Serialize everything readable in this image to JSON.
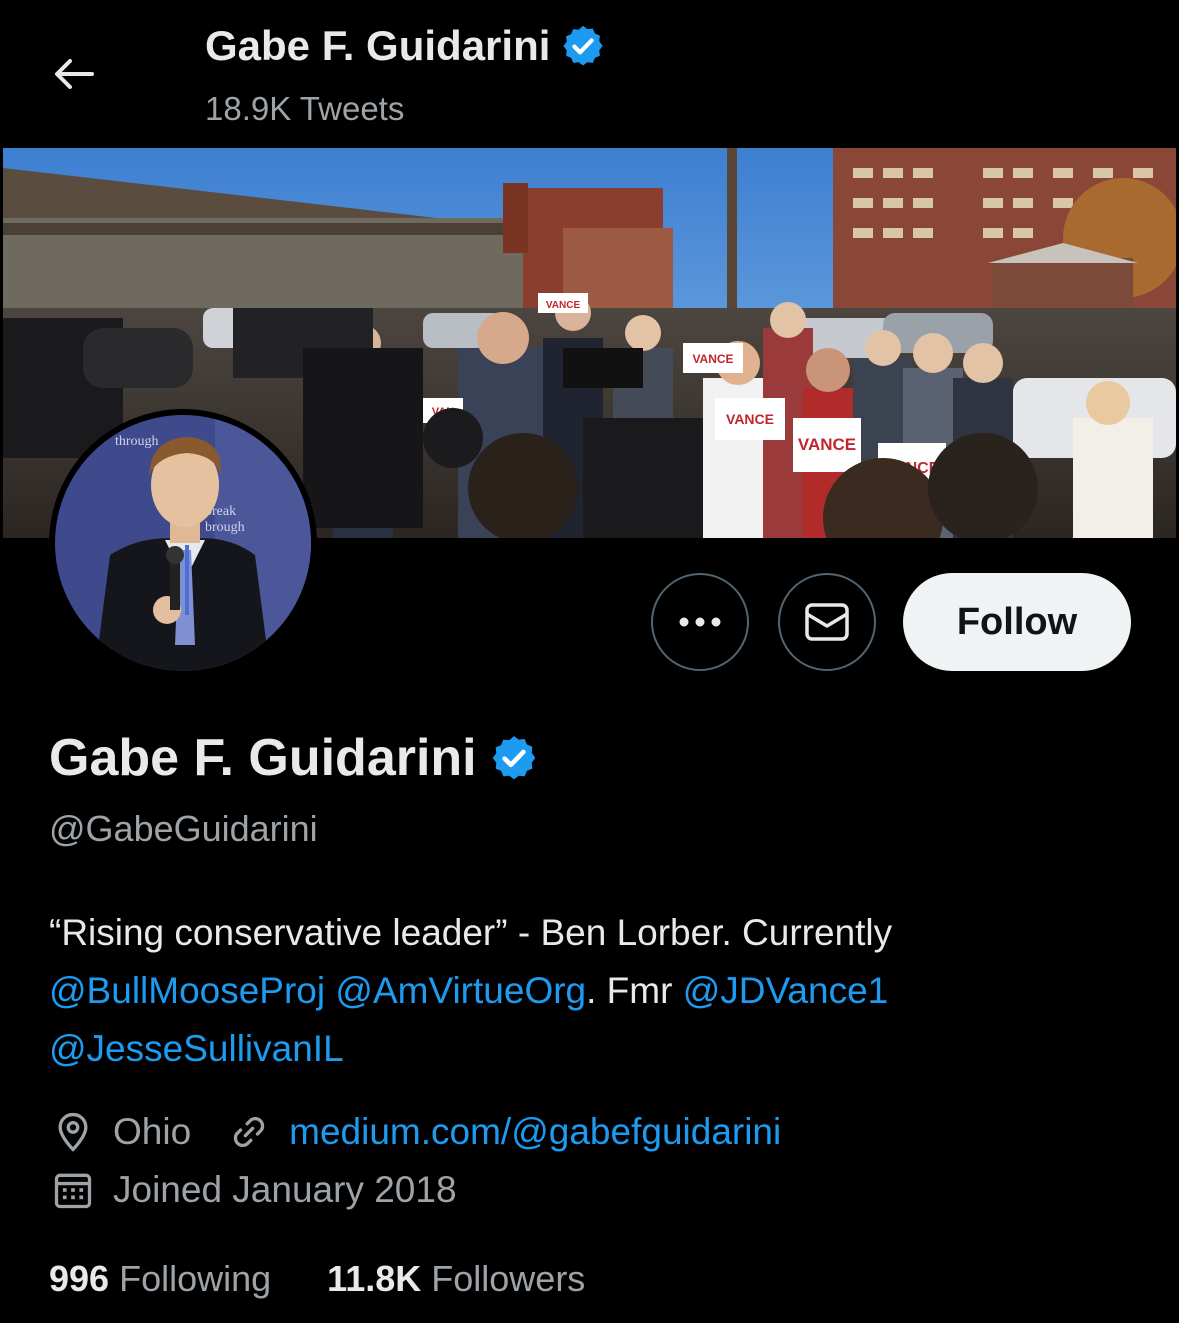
{
  "header": {
    "title": "Gabe F. Guidarini",
    "tweet_count": "18.9K Tweets"
  },
  "actions": {
    "follow_label": "Follow"
  },
  "profile": {
    "name": "Gabe F. Guidarini",
    "handle": "@GabeGuidarini",
    "bio": {
      "text_1": "“Rising conservative leader” - Ben Lorber. Currently",
      "mention_1": "@BullMooseProj",
      "mention_2": "@AmVirtueOrg",
      "text_2": ". Fmr ",
      "mention_3": "@JDVance1",
      "mention_4": "@JesseSullivanIL"
    },
    "location": "Ohio",
    "website": "medium.com/@gabefguidarini",
    "joined": "Joined January 2018",
    "following_count": "996",
    "following_label": "Following",
    "followers_count": "11.8K",
    "followers_label": "Followers"
  },
  "banner_signs": [
    "VANCE",
    "VANCE",
    "VANCE",
    "VANCE",
    "VANCE",
    "VAN"
  ],
  "avatar_backdrop_text": [
    "through",
    "break",
    "brough"
  ],
  "colors": {
    "background": "#000000",
    "accent": "#1d9bf0",
    "secondary_text": "#9ea3a8",
    "follow_bg": "#eff3f4"
  },
  "icons": [
    "back-arrow-icon",
    "verified-badge-icon",
    "more-icon",
    "mail-icon",
    "location-pin-icon",
    "link-icon",
    "calendar-icon"
  ]
}
